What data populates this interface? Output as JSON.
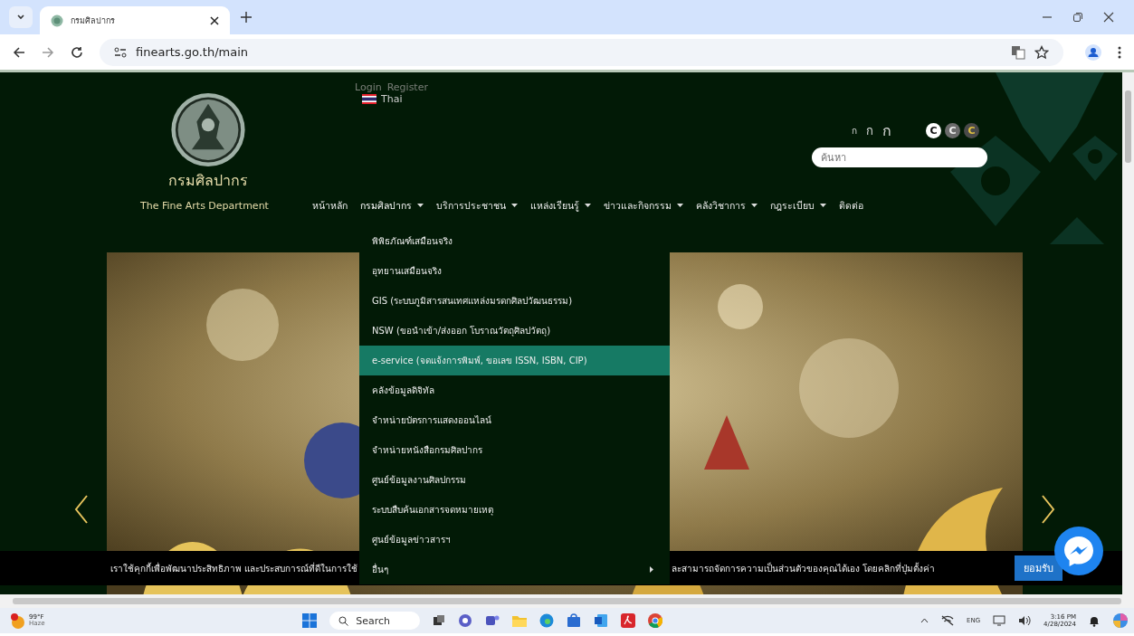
{
  "browser": {
    "tab_title": "กรมศิลปากร",
    "url": "finearts.go.th/main"
  },
  "site": {
    "name_th": "กรมศิลปากร",
    "name_en": "The Fine Arts Department",
    "login": "Login",
    "register": "Register",
    "language": "Thai",
    "font_sizes": [
      "ก",
      "ก",
      "ก"
    ],
    "contrast": [
      {
        "label": "C",
        "color": "#ffffff"
      },
      {
        "label": "C",
        "color": "#6b6b6b"
      },
      {
        "label": "C",
        "color": "#4a4a4a"
      }
    ],
    "search": {
      "placeholder": "ค้นหา"
    }
  },
  "nav": [
    {
      "label": "หน้าหลัก",
      "has_menu": false,
      "expanded": false
    },
    {
      "label": "กรมศิลปากร",
      "has_menu": true,
      "expanded": true,
      "menu": [
        {
          "label": "พิพิธภัณฑ์เสมือนจริง",
          "selected": false,
          "submenu": false
        },
        {
          "label": "อุทยานเสมือนจริง",
          "selected": false,
          "submenu": false
        },
        {
          "label": "GIS (ระบบภูมิสารสนเทศแหล่งมรดกศิลปวัฒนธรรม)",
          "selected": false,
          "submenu": false
        },
        {
          "label": "NSW (ขอนำเข้า/ส่งออก โบราณวัตถุศิลปวัตถุ)",
          "selected": false,
          "submenu": false
        },
        {
          "label": "e-service (จดแจ้งการพิมพ์, ขอเลข ISSN, ISBN, CIP)",
          "selected": true,
          "submenu": false
        },
        {
          "label": "คลังข้อมูลดิจิทัล",
          "selected": false,
          "submenu": false
        },
        {
          "label": "จำหน่ายบัตรการแสดงออนไลน์",
          "selected": false,
          "submenu": false
        },
        {
          "label": "จำหน่ายหนังสือกรมศิลปากร",
          "selected": false,
          "submenu": false
        },
        {
          "label": "ศูนย์ข้อมูลงานศิลปกรรม",
          "selected": false,
          "submenu": false
        },
        {
          "label": "ระบบสืบค้นเอกสารจดหมายเหตุ",
          "selected": false,
          "submenu": false
        },
        {
          "label": "ศูนย์ข้อมูลข่าวสารฯ",
          "selected": false,
          "submenu": false
        },
        {
          "label": "อื่นๆ",
          "selected": false,
          "submenu": true
        }
      ]
    },
    {
      "label": "บริการประชาชน",
      "has_menu": true,
      "expanded": false
    },
    {
      "label": "แหล่งเรียนรู้",
      "has_menu": true,
      "expanded": false
    },
    {
      "label": "ข่าวและกิจกรรม",
      "has_menu": true,
      "expanded": false
    },
    {
      "label": "คลังวิชาการ",
      "has_menu": true,
      "expanded": false
    },
    {
      "label": "กฎระเบียบ",
      "has_menu": true,
      "expanded": false
    },
    {
      "label": "ติดต่อ",
      "has_menu": false,
      "expanded": false
    }
  ],
  "cookie_bar": {
    "text_left": "เราใช้คุกกี้เพื่อพัฒนาประสิทธิภาพ และประสบการณ์ที่ดีในการใช้",
    "text_right": "ละสามารถจัดการความเป็นส่วนตัวของคุณได้เอง โดยคลิกที่ปุ่มตั้งค่า",
    "accept": "ยอมรับ"
  },
  "taskbar": {
    "temperature": "99°F",
    "weather": "Haze",
    "search": "Search",
    "language": "ENG",
    "time": "3:16 PM",
    "date": "4/28/2024"
  }
}
